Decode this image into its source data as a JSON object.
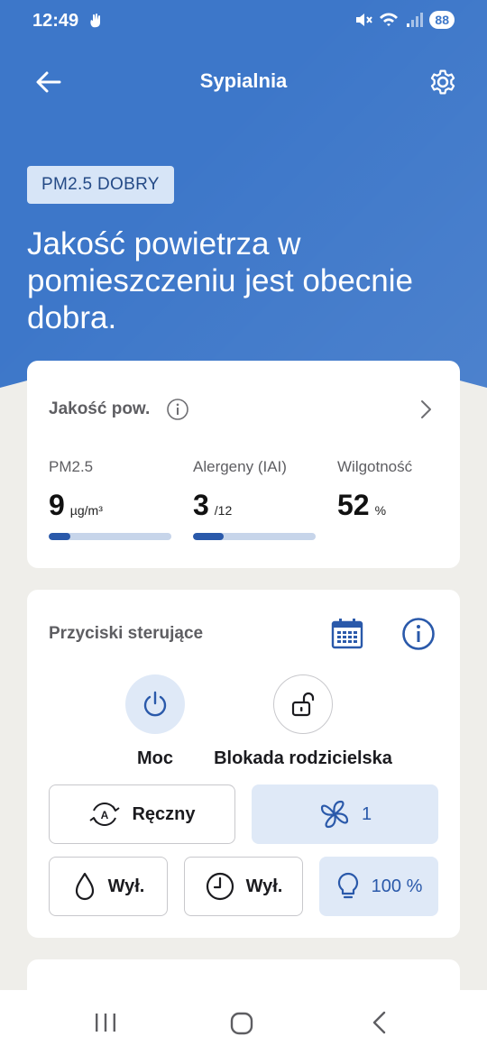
{
  "status_bar": {
    "time": "12:49",
    "battery": "88"
  },
  "header": {
    "title": "Sypialnia"
  },
  "hero": {
    "badge": "PM2.5 DOBRY",
    "headline": "Jakość powietrza w pomieszczeniu jest obecnie dobra."
  },
  "air_quality": {
    "title": "Jakość pow.",
    "metrics": [
      {
        "label": "PM2.5",
        "value": "9",
        "unit": "µg/m³",
        "level": 0.18
      },
      {
        "label": "Alergeny (IAI)",
        "value": "3",
        "unit": "/12",
        "level": 0.25
      },
      {
        "label": "Wilgotność",
        "value": "52",
        "unit": "%"
      }
    ]
  },
  "controls": {
    "title": "Przyciski sterujące",
    "power_label": "Moc",
    "child_lock_label": "Blokada rodzicielska",
    "mode_label": "Ręczny",
    "fan_speed": "1",
    "humidity_label": "Wył.",
    "timer_label": "Wył.",
    "light_label": "100 %"
  },
  "colors": {
    "accent": "#3d77c9",
    "accent_dark": "#2a59aa",
    "chip_bg": "#dfe9f7",
    "background": "#efeeea"
  },
  "icons": {
    "back": "arrow-left-icon",
    "settings": "gear-icon",
    "info": "info-icon",
    "calendar": "calendar-icon",
    "power": "power-icon",
    "lock": "unlock-icon",
    "mode": "auto-cycle-icon",
    "fan": "fan-icon",
    "humidity": "droplet-icon",
    "timer": "clock-icon",
    "light": "bulb-icon"
  }
}
